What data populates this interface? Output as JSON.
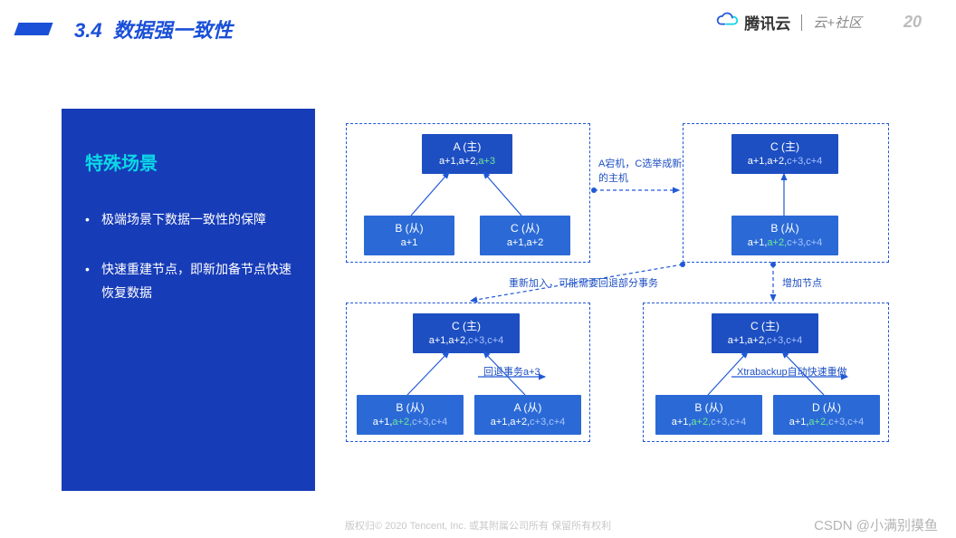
{
  "header": {
    "section": "3.4",
    "title": "数据强一致性",
    "brand": "腾讯云",
    "community": "云+社区",
    "page": "20"
  },
  "panel": {
    "title": "特殊场景",
    "items": [
      "极端场景下数据一致性的保障",
      "快速重建节点，即新加备节点快速恢复数据"
    ]
  },
  "stages": {
    "s1": {
      "A": {
        "title": "A (主)",
        "base": "a+1,a+2,",
        "extra": "a+3"
      },
      "B": {
        "title": "B (从)",
        "base": "a+1"
      },
      "C": {
        "title": "C (从)",
        "base": "a+1,a+2"
      }
    },
    "s2": {
      "C": {
        "title": "C (主)",
        "base": "a+1,a+2,",
        "extra": "c+3,c+4"
      },
      "B": {
        "title": "B (从)",
        "base": "a+1,",
        "extra1": "a+2,",
        "extra2": "c+3,c+4"
      }
    },
    "s3": {
      "C": {
        "title": "C (主)",
        "base": "a+1,a+2,",
        "extra": "c+3,c+4"
      },
      "B": {
        "title": "B (从)",
        "base": "a+1,",
        "extra1": "a+2,",
        "extra2": "c+3,c+4"
      },
      "A": {
        "title": "A (从)",
        "base": "a+1,a+2,",
        "extra": "c+3,c+4"
      }
    },
    "s4": {
      "C": {
        "title": "C (主)",
        "base": "a+1,a+2,",
        "extra": "c+3,c+4"
      },
      "B": {
        "title": "B (从)",
        "base": "a+1,",
        "extra1": "a+2,",
        "extra2": "c+3,c+4"
      },
      "D": {
        "title": "D (从)",
        "base": "a+1,",
        "extra1": "a+2,",
        "extra2": "c+3,c+4"
      }
    }
  },
  "annotations": {
    "a1": "A宕机，C选举成新的主机",
    "a2": "重新加入，可能需要回退部分事务",
    "a3": "增加节点",
    "a4": "回退事务a+3",
    "a5": "Xtrabackup自动快速重做"
  },
  "footer": "版权归© 2020 Tencent, Inc. 或其附属公司所有 保留所有权利",
  "watermark": "CSDN @小满别摸鱼"
}
